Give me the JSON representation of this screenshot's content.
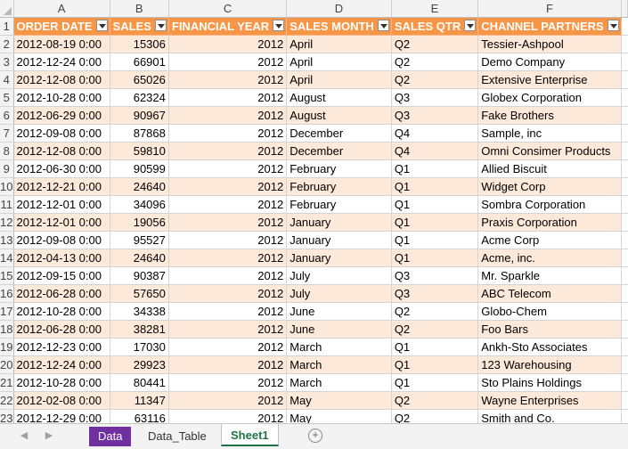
{
  "columns": [
    "A",
    "B",
    "C",
    "D",
    "E",
    "F"
  ],
  "headers": [
    "ORDER DATE",
    "SALES",
    "FINANCIAL YEAR",
    "SALES MONTH",
    "SALES QTR",
    "CHANNEL PARTNERS"
  ],
  "header_row_number": "1",
  "rows": [
    {
      "n": "2",
      "date": "2012-08-19 0:00",
      "sales": "15306",
      "year": "2012",
      "month": "April",
      "qtr": "Q2",
      "partner": "Tessier-Ashpool"
    },
    {
      "n": "3",
      "date": "2012-12-24 0:00",
      "sales": "66901",
      "year": "2012",
      "month": "April",
      "qtr": "Q2",
      "partner": "Demo Company"
    },
    {
      "n": "4",
      "date": "2012-12-08 0:00",
      "sales": "65026",
      "year": "2012",
      "month": "April",
      "qtr": "Q2",
      "partner": "Extensive Enterprise"
    },
    {
      "n": "5",
      "date": "2012-10-28 0:00",
      "sales": "62324",
      "year": "2012",
      "month": "August",
      "qtr": "Q3",
      "partner": "Globex Corporation"
    },
    {
      "n": "6",
      "date": "2012-06-29 0:00",
      "sales": "90967",
      "year": "2012",
      "month": "August",
      "qtr": "Q3",
      "partner": "Fake Brothers"
    },
    {
      "n": "7",
      "date": "2012-09-08 0:00",
      "sales": "87868",
      "year": "2012",
      "month": "December",
      "qtr": "Q4",
      "partner": "Sample, inc"
    },
    {
      "n": "8",
      "date": "2012-12-08 0:00",
      "sales": "59810",
      "year": "2012",
      "month": "December",
      "qtr": "Q4",
      "partner": "Omni Consimer Products"
    },
    {
      "n": "9",
      "date": "2012-06-30 0:00",
      "sales": "90599",
      "year": "2012",
      "month": "February",
      "qtr": "Q1",
      "partner": "Allied Biscuit"
    },
    {
      "n": "10",
      "date": "2012-12-21 0:00",
      "sales": "24640",
      "year": "2012",
      "month": "February",
      "qtr": "Q1",
      "partner": "Widget Corp"
    },
    {
      "n": "11",
      "date": "2012-12-01 0:00",
      "sales": "34096",
      "year": "2012",
      "month": "February",
      "qtr": "Q1",
      "partner": "Sombra Corporation"
    },
    {
      "n": "12",
      "date": "2012-12-01 0:00",
      "sales": "19056",
      "year": "2012",
      "month": "January",
      "qtr": "Q1",
      "partner": "Praxis Corporation"
    },
    {
      "n": "13",
      "date": "2012-09-08 0:00",
      "sales": "95527",
      "year": "2012",
      "month": "January",
      "qtr": "Q1",
      "partner": "Acme Corp"
    },
    {
      "n": "14",
      "date": "2012-04-13 0:00",
      "sales": "24640",
      "year": "2012",
      "month": "January",
      "qtr": "Q1",
      "partner": "Acme, inc."
    },
    {
      "n": "15",
      "date": "2012-09-15 0:00",
      "sales": "90387",
      "year": "2012",
      "month": "July",
      "qtr": "Q3",
      "partner": "Mr. Sparkle"
    },
    {
      "n": "16",
      "date": "2012-06-28 0:00",
      "sales": "57650",
      "year": "2012",
      "month": "July",
      "qtr": "Q3",
      "partner": "ABC Telecom"
    },
    {
      "n": "17",
      "date": "2012-10-28 0:00",
      "sales": "34338",
      "year": "2012",
      "month": "June",
      "qtr": "Q2",
      "partner": "Globo-Chem"
    },
    {
      "n": "18",
      "date": "2012-06-28 0:00",
      "sales": "38281",
      "year": "2012",
      "month": "June",
      "qtr": "Q2",
      "partner": "Foo Bars"
    },
    {
      "n": "19",
      "date": "2012-12-23 0:00",
      "sales": "17030",
      "year": "2012",
      "month": "March",
      "qtr": "Q1",
      "partner": "Ankh-Sto Associates"
    },
    {
      "n": "20",
      "date": "2012-12-24 0:00",
      "sales": "29923",
      "year": "2012",
      "month": "March",
      "qtr": "Q1",
      "partner": "123 Warehousing"
    },
    {
      "n": "21",
      "date": "2012-10-28 0:00",
      "sales": "80441",
      "year": "2012",
      "month": "March",
      "qtr": "Q1",
      "partner": "Sto Plains Holdings"
    },
    {
      "n": "22",
      "date": "2012-02-08 0:00",
      "sales": "11347",
      "year": "2012",
      "month": "May",
      "qtr": "Q2",
      "partner": "Wayne Enterprises"
    },
    {
      "n": "23",
      "date": "2012-12-29 0:00",
      "sales": "63116",
      "year": "2012",
      "month": "May",
      "qtr": "Q2",
      "partner": "Smith and Co."
    }
  ],
  "sheet_tabs": [
    {
      "label": "Data",
      "color": "#7030a0",
      "active": false
    },
    {
      "label": "Data_Table",
      "active": false
    },
    {
      "label": "Sheet1",
      "active": true
    }
  ],
  "colors": {
    "header_fill": "#f79646",
    "band_fill": "#fde9d9",
    "active_tab_text": "#217346"
  },
  "icons": {
    "filter": "filter-dropdown-icon",
    "add_sheet": "plus-circle-icon",
    "prev": "chevron-left-icon",
    "next": "chevron-right-icon"
  }
}
